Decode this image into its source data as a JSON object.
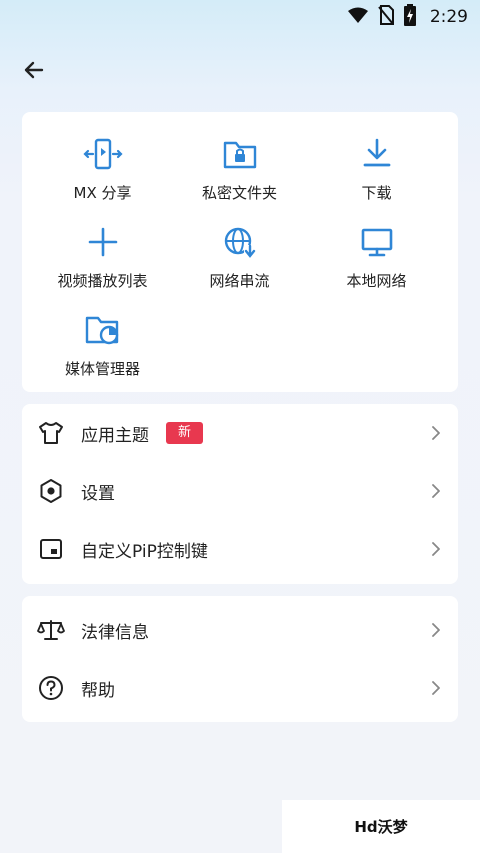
{
  "status_bar": {
    "time": "2:29",
    "icons": [
      "wifi-icon",
      "no-sim-icon",
      "battery-charging-icon"
    ]
  },
  "header": {
    "back_icon": "arrow-left-icon"
  },
  "grid": [
    {
      "label": "MX 分享",
      "icon": "mx-share-icon"
    },
    {
      "label": "私密文件夹",
      "icon": "private-folder-icon"
    },
    {
      "label": "下载",
      "icon": "download-icon"
    },
    {
      "label": "视频播放列表",
      "icon": "plus-icon"
    },
    {
      "label": "网络串流",
      "icon": "network-stream-icon"
    },
    {
      "label": "本地网络",
      "icon": "monitor-icon"
    },
    {
      "label": "媒体管理器",
      "icon": "media-manager-icon"
    }
  ],
  "settings": [
    {
      "label": "应用主题",
      "icon": "tshirt-icon",
      "badge": "新"
    },
    {
      "label": "设置",
      "icon": "hexagon-settings-icon"
    },
    {
      "label": "自定义PiP控制键",
      "icon": "pip-icon"
    }
  ],
  "legal": [
    {
      "label": "法律信息",
      "icon": "scale-icon"
    },
    {
      "label": "帮助",
      "icon": "help-icon"
    }
  ],
  "watermark": {
    "text": "Hd沃梦"
  },
  "colors": {
    "accent": "#2f86d6",
    "badge": "#e8384f",
    "background": "#f2f4f9"
  }
}
